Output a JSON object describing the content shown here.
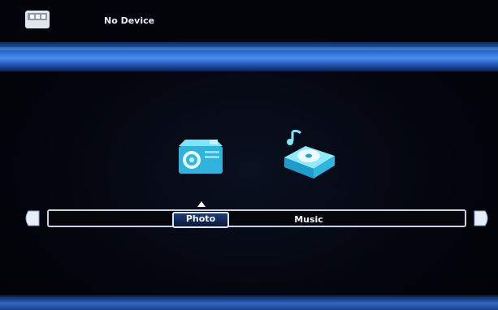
{
  "header": {
    "device_status": "No Device",
    "device_icon": "device-icon"
  },
  "menu": {
    "selected": "Photo",
    "items": [
      {
        "label": "Photo",
        "icon": "camera-icon"
      },
      {
        "label": "Music",
        "icon": "music-player-icon"
      }
    ],
    "nav": {
      "left": "arrow-left-icon",
      "right": "arrow-right-icon"
    }
  },
  "colors": {
    "band_blue": "#3a7ee6",
    "icon_cyan": "#4fd3f0",
    "text": "#f2f5fa"
  }
}
